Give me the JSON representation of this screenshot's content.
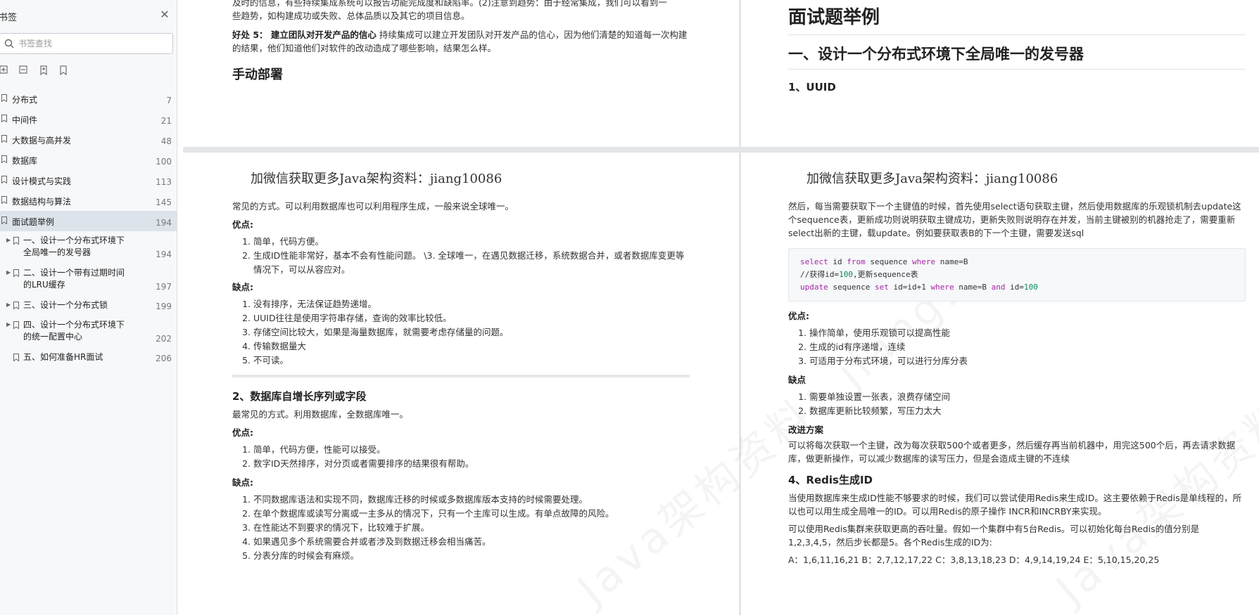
{
  "sidebar": {
    "title": "书签",
    "search_placeholder": "书签查找",
    "tools": [
      "expand-all-icon",
      "collapse-all-icon",
      "add-bookmark-icon",
      "bookmark-icon"
    ],
    "items": [
      {
        "label": "分布式",
        "page": "7"
      },
      {
        "label": "中间件",
        "page": "21"
      },
      {
        "label": "大数据与高并发",
        "page": "48"
      },
      {
        "label": "数据库",
        "page": "100"
      },
      {
        "label": "设计模式与实践",
        "page": "113"
      },
      {
        "label": "数据结构与算法",
        "page": "145"
      },
      {
        "label": "面试题举例",
        "page": "194"
      }
    ],
    "subitems": [
      {
        "label": "一、设计一个分布式环境下全局唯一的发号器",
        "page": "194"
      },
      {
        "label": "二、设计一个带有过期时间的LRU缓存",
        "page": "197"
      },
      {
        "label": "三、设计一个分布式锁",
        "page": "199"
      },
      {
        "label": "四、设计一个分布式环境下的统一配置中心",
        "page": "202"
      },
      {
        "label": "五、如何准备HR面试",
        "page": "206"
      }
    ]
  },
  "page_tl": {
    "line1": "及时的信息，有些持续集成系统可以报告功能完成度和缺陷率。(2)注意到趋势：由于经常集成，我们可以看到一",
    "line2": "些趋势，如构建成功或失败、总体品质以及其它的项目信息。",
    "benefit5_label": "好处 5：  建立团队对开发产品的信心",
    "benefit5_text": " 持续集成可以建立开发团队对开发产品的信心，因为他们清楚的知道每一次构建的结果，他们知道他们对软件的改动造成了哪些影响，结果怎么样。",
    "heading": "手动部署"
  },
  "page_tr": {
    "title": "面试题举例",
    "section": "一、设计一个分布式环境下全局唯一的发号器",
    "sub": "1、UUID"
  },
  "page_bl": {
    "wechat": "加微信获取更多Java架构资料：jiang10086",
    "intro": "常见的方式。可以利用数据库也可以利用程序生成，一般来说全球唯一。",
    "pros_label": "优点:",
    "pros": [
      "简单，代码方便。",
      "生成ID性能非常好，基本不会有性能问题。 \\3. 全球唯一，在遇见数据迁移，系统数据合并，或者数据库变更等情况下，可以从容应对。"
    ],
    "cons_label": "缺点:",
    "cons": [
      "没有排序，无法保证趋势递增。",
      "UUID往往是使用字符串存储，查询的效率比较低。",
      "存储空间比较大，如果是海量数据库，就需要考虑存储量的问题。",
      "传输数据量大",
      "不可读。"
    ],
    "section2": "2、数据库自增长序列或字段",
    "section2_intro": "最常见的方式。利用数据库，全数据库唯一。",
    "pros2_label": "优点:",
    "pros2": [
      "简单，代码方便，性能可以接受。",
      "数字ID天然排序，对分页或者需要排序的结果很有帮助。"
    ],
    "cons2_label": "缺点:",
    "cons2": [
      "不同数据库语法和实现不同，数据库迁移的时候或多数据库版本支持的时候需要处理。",
      "在单个数据库或读写分离或一主多从的情况下，只有一个主库可以生成。有单点故障的风险。",
      "在性能达不到要求的情况下，比较难于扩展。",
      "如果遇见多个系统需要合并或者涉及到数据迁移会相当痛苦。",
      "分表分库的时候会有麻烦。"
    ]
  },
  "page_br": {
    "wechat": "加微信获取更多Java架构资料：jiang10086",
    "intro": "然后，每当需要获取下一个主键值的时候，首先使用select语句获取主键，然后使用数据库的乐观锁机制去update这个sequence表，更新成功则说明获取主键成功，更新失败则说明存在并发，当前主键被别的机器抢走了，需要重新select出新的主键，载update。例如要获取表B的下一个主键，需要发送sql",
    "code": {
      "l1": [
        "select",
        " id ",
        "from",
        " sequence ",
        "where",
        " name=B"
      ],
      "l2": [
        "//获得id=",
        "100",
        ",更新sequence表"
      ],
      "l3": [
        "update",
        " sequence ",
        "set",
        " id=id+1 ",
        "where",
        " name=B ",
        "and",
        " id=",
        "100"
      ]
    },
    "pros_label": "优点:",
    "pros": [
      "操作简单，使用乐观锁可以提高性能",
      "生成的id有序递增，连续",
      "可适用于分布式环境，可以进行分库分表"
    ],
    "cons_label": "缺点",
    "cons": [
      "需要单独设置一张表，浪费存储空间",
      "数据库更新比较频繁，写压力太大"
    ],
    "improve_label": "改进方案",
    "improve_text": "可以将每次获取一个主键，改为每次获取500个或者更多，然后缓存再当前机器中，用完这500个后，再去请求数据库，做更新操作，可以减少数据库的读写压力，但是会造成主键的不连续",
    "section4": "4、Redis生成ID",
    "p1": "当使用数据库来生成ID性能不够要求的时候，我们可以尝试使用Redis来生成ID。这主要依赖于Redis是单线程的，所以也可以用生成全局唯一的ID。可以用Redis的原子操作 INCR和INCRBY来实现。",
    "p2": "可以使用Redis集群来获取更高的吞吐量。假如一个集群中有5台Redis。可以初始化每台Redis的值分别是1,2,3,4,5，然后步长都是5。各个Redis生成的ID为:",
    "p3": "A：1,6,11,16,21 B：2,7,12,17,22 C：3,8,13,18,23 D：4,9,14,19,24 E：5,10,15,20,25"
  },
  "watermark": "Java架构资料：jiang10"
}
